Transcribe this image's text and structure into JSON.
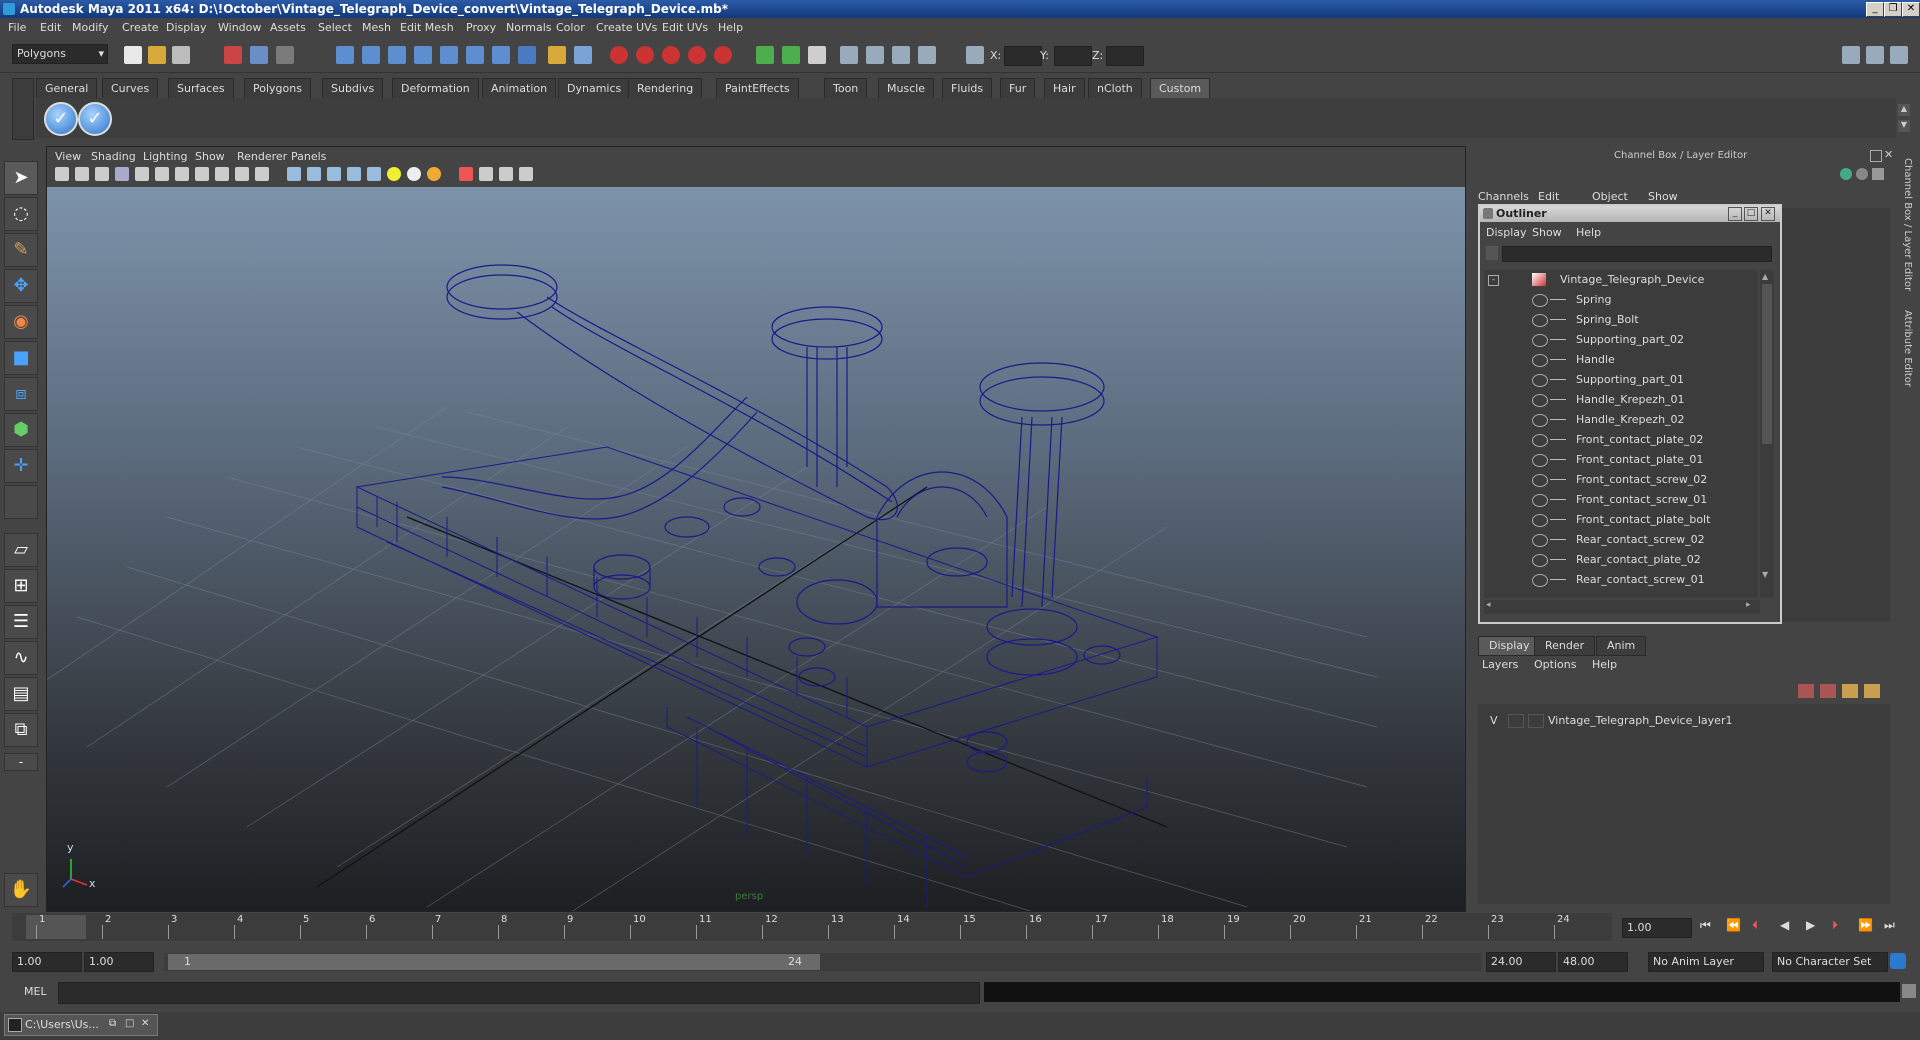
{
  "window": {
    "title": "Autodesk Maya 2011 x64: D:\\!October\\Vintage_Telegraph_Device_convert\\Vintage_Telegraph_Device.mb*"
  },
  "menubar": [
    "File",
    "Edit",
    "Modify",
    "Create",
    "Display",
    "Window",
    "Assets",
    "Select",
    "Mesh",
    "Edit Mesh",
    "Proxy",
    "Normals",
    "Color",
    "Create UVs",
    "Edit UVs",
    "Help"
  ],
  "statusline": {
    "mode": "Polygons",
    "x_label": "X:",
    "y_label": "Y:",
    "z_label": "Z:"
  },
  "shelf": {
    "tabs": [
      "General",
      "Curves",
      "Surfaces",
      "Polygons",
      "Subdivs",
      "Deformation",
      "Animation",
      "Dynamics",
      "Rendering",
      "PaintEffects",
      "Toon",
      "Muscle",
      "Fluids",
      "Fur",
      "Hair",
      "nCloth",
      "Custom"
    ],
    "active_tab": "Custom"
  },
  "viewport": {
    "menu": [
      "View",
      "Shading",
      "Lighting",
      "Show",
      "Renderer",
      "Panels"
    ],
    "camera_label": "persp",
    "axis_y": "y",
    "axis_x": "x"
  },
  "channelbox": {
    "title": "Channel Box / Layer Editor",
    "menu": [
      "Channels",
      "Edit",
      "Object",
      "Show"
    ]
  },
  "outliner": {
    "title": "Outliner",
    "menu": [
      "Display",
      "Show",
      "Help"
    ],
    "root": "Vintage_Telegraph_Device",
    "items": [
      "Spring",
      "Spring_Bolt",
      "Supporting_part_02",
      "Handle",
      "Supporting_part_01",
      "Handle_Krepezh_01",
      "Handle_Krepezh_02",
      "Front_contact_plate_02",
      "Front_contact_plate_01",
      "Front_contact_screw_02",
      "Front_contact_screw_01",
      "Front_contact_plate_bolt",
      "Rear_contact_screw_02",
      "Rear_contact_plate_02",
      "Rear_contact_screw_01"
    ]
  },
  "layers": {
    "tabs": [
      "Display",
      "Render",
      "Anim"
    ],
    "menu": [
      "Layers",
      "Options",
      "Help"
    ],
    "visibility": "V",
    "layer_name": "Vintage_Telegraph_Device_layer1"
  },
  "side_tabs": [
    "Channel Box / Layer Editor",
    "Attribute Editor"
  ],
  "timeline": {
    "ticks": [
      "1",
      "2",
      "3",
      "4",
      "5",
      "6",
      "7",
      "8",
      "9",
      "10",
      "11",
      "12",
      "13",
      "14",
      "15",
      "16",
      "17",
      "18",
      "19",
      "20",
      "21",
      "22",
      "23",
      "24"
    ],
    "current_frame": "1.00"
  },
  "range": {
    "start": "1.00",
    "start2": "1.00",
    "slider_start": "1",
    "slider_end": "24",
    "end": "24.00",
    "end2": "48.00",
    "anim_layer": "No Anim Layer",
    "char_set": "No Character Set"
  },
  "cmdline": {
    "label": "MEL"
  },
  "taskbar": {
    "item": "C:\\Users\\Us..."
  }
}
